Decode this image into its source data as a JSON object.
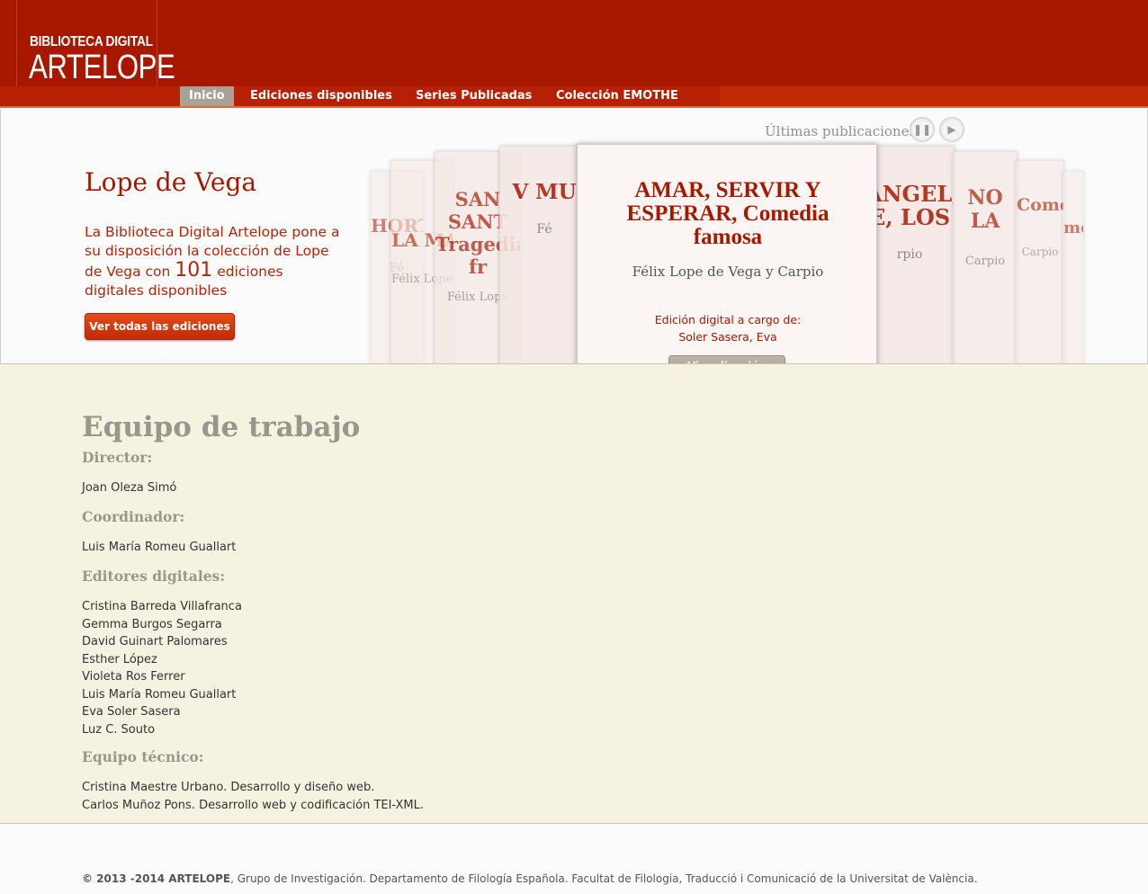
{
  "header": {
    "logo_line1": "BIBLIOTECA DIGITAL",
    "logo_line2": "ARTELOPE",
    "nav": [
      {
        "label": "Inicio"
      },
      {
        "label": "Ediciones disponibles"
      },
      {
        "label": "Series Publicadas"
      },
      {
        "label": "Colección EMOTHE"
      }
    ]
  },
  "hero": {
    "title": "Lope de Vega",
    "text_before": "La Biblioteca Digital Artelope pone a su disposición la colección de Lope de Vega con ",
    "count": "101",
    "text_after": " ediciones digitales disponibles",
    "button": "Ver todas las ediciones >>"
  },
  "carousel": {
    "label": "Últimas publicaciones",
    "pause_icon": "pause-icon",
    "next_icon": "play-icon",
    "featured": {
      "title": "AMAR, SERVIR Y ESPERAR, Comedia famosa",
      "author": "Félix Lope de Vega y Carpio",
      "edition_label": "Edición digital a cargo de:",
      "editor": "Soler Sasera, Eva",
      "button": "Visualización HTML"
    },
    "back_cards": [
      {
        "title": "HORT LA",
        "author": "Fé"
      },
      {
        "title": "LA MADRE",
        "author": "Félix Lope"
      },
      {
        "title": "SAN SANT Tragedia fr",
        "author": "Félix Lope"
      },
      {
        "title": "V MU",
        "author": "Fé"
      },
      {
        "title": "ÁNGEL, E, LOS",
        "author": "rpio"
      },
      {
        "title": "NO LA",
        "author": "Carpio"
      },
      {
        "title": "Comedia",
        "author": "Carpio"
      },
      {
        "title": "media",
        "author": ""
      }
    ]
  },
  "team": {
    "title": "Equipo de trabajo",
    "sections": [
      {
        "heading": "Director:",
        "members": [
          "Joan Oleza Simó"
        ]
      },
      {
        "heading": "Coordinador:",
        "members": [
          "Luis María Romeu Guallart"
        ]
      },
      {
        "heading": "Editores digitales:",
        "members": [
          "Cristina Barreda Villafranca",
          "Gemma Burgos Segarra",
          "David Guinart Palomares",
          "Esther López",
          "Violeta Ros Ferrer",
          "Luis María Romeu Guallart",
          "Eva Soler Sasera",
          "Luz C. Souto"
        ]
      },
      {
        "heading": "Equipo técnico:",
        "members": [
          "Cristina Maestre Urbano. Desarrollo y diseño web.",
          "Carlos Muñoz Pons. Desarrollo web y codificación TEI-XML."
        ]
      }
    ]
  },
  "footer": {
    "copyright": "© 2013 -2014 ARTELOPE",
    "text": ", Grupo de Investigación. Departamento de Filología Española. Facultat de Filologia, Traducció i Comunicació de la Universitat de València."
  }
}
